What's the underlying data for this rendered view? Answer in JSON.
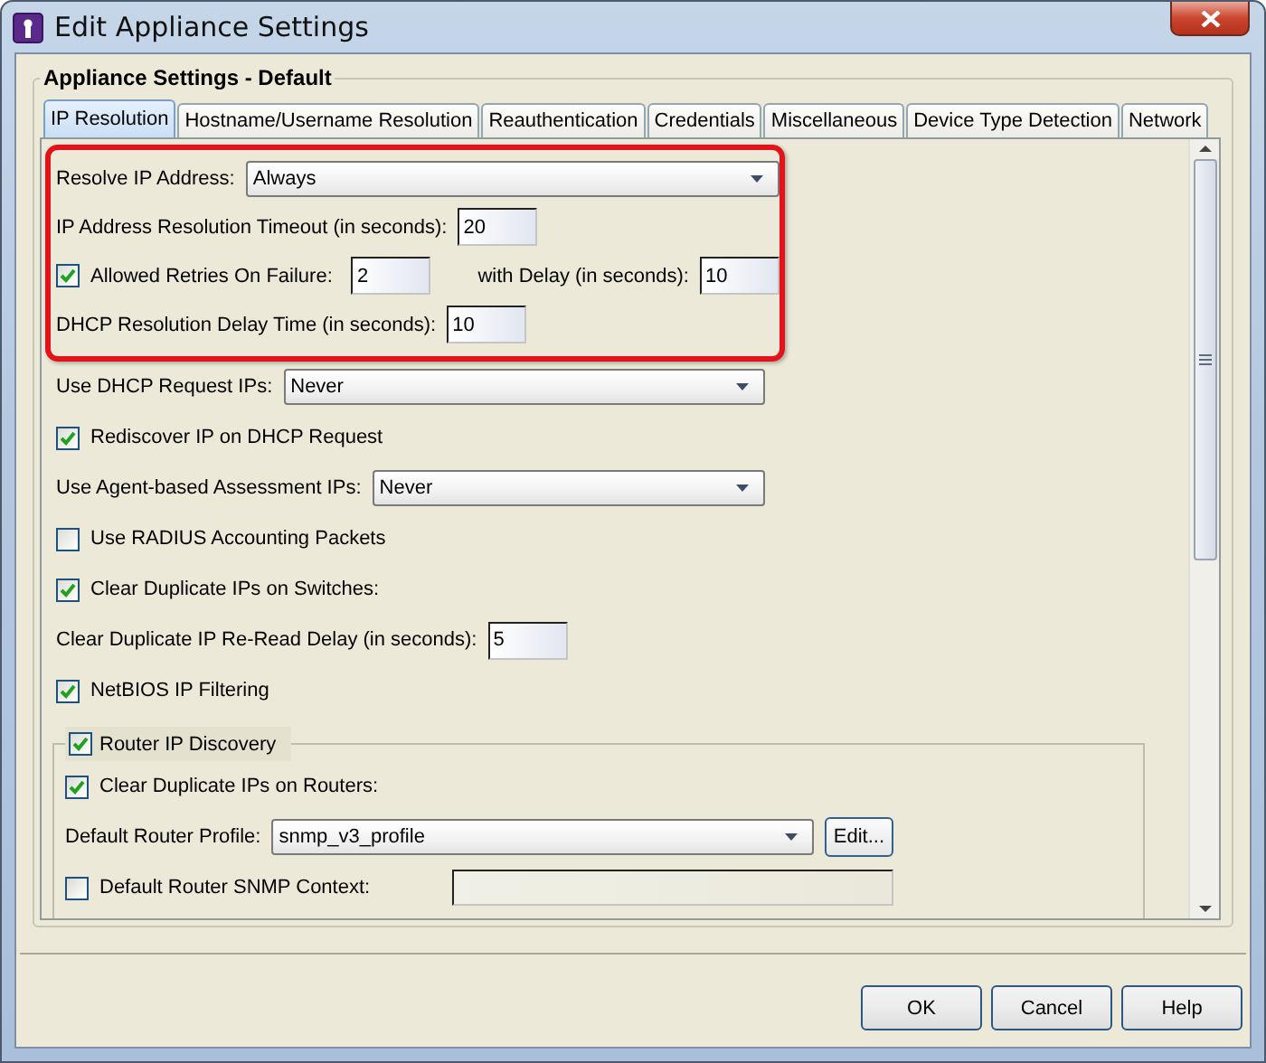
{
  "window": {
    "title": "Edit Appliance Settings"
  },
  "group_title": "Appliance Settings - Default",
  "tabs": [
    {
      "label": "IP Resolution",
      "selected": true
    },
    {
      "label": "Hostname/Username Resolution",
      "selected": false
    },
    {
      "label": "Reauthentication",
      "selected": false
    },
    {
      "label": "Credentials",
      "selected": false
    },
    {
      "label": "Miscellaneous",
      "selected": false
    },
    {
      "label": "Device Type Detection",
      "selected": false
    },
    {
      "label": "Network",
      "selected": false
    }
  ],
  "highlighted_rows": [
    {
      "kind": "select",
      "label": "Resolve IP Address:",
      "value": "Always"
    },
    {
      "kind": "number",
      "label": "IP Address Resolution Timeout (in seconds):",
      "value": "20"
    },
    {
      "kind": "check_numbers",
      "checked": true,
      "label": "Allowed Retries On Failure:",
      "value": "2",
      "label_2": "with Delay (in seconds):",
      "value_2": "10"
    },
    {
      "kind": "number",
      "label": "DHCP Resolution Delay Time (in seconds):",
      "value": "10"
    }
  ],
  "rows": [
    {
      "kind": "select",
      "label": "Use DHCP Request IPs:",
      "value": "Never"
    },
    {
      "kind": "check",
      "checked": true,
      "label": "Rediscover IP on DHCP Request"
    },
    {
      "kind": "select",
      "label": "Use Agent-based Assessment IPs:",
      "value": "Never"
    },
    {
      "kind": "check",
      "checked": false,
      "label": "Use RADIUS Accounting Packets"
    },
    {
      "kind": "check",
      "checked": true,
      "label": "Clear Duplicate IPs on Switches:"
    },
    {
      "kind": "number",
      "label": "Clear Duplicate IP Re-Read Delay (in seconds):",
      "value": "5"
    },
    {
      "kind": "check",
      "checked": true,
      "label": "NetBIOS IP Filtering"
    }
  ],
  "router_group": {
    "checked": true,
    "label": "Router IP Discovery",
    "rows": [
      {
        "kind": "check",
        "checked": true,
        "label": "Clear Duplicate IPs on Routers:"
      },
      {
        "kind": "select_edit",
        "label": "Default Router Profile:",
        "value": "snmp_v3_profile",
        "button": "Edit..."
      },
      {
        "kind": "check_text",
        "checked": false,
        "label": "Default Router SNMP Context:"
      }
    ]
  },
  "buttons": [
    "OK",
    "Cancel",
    "Help"
  ]
}
